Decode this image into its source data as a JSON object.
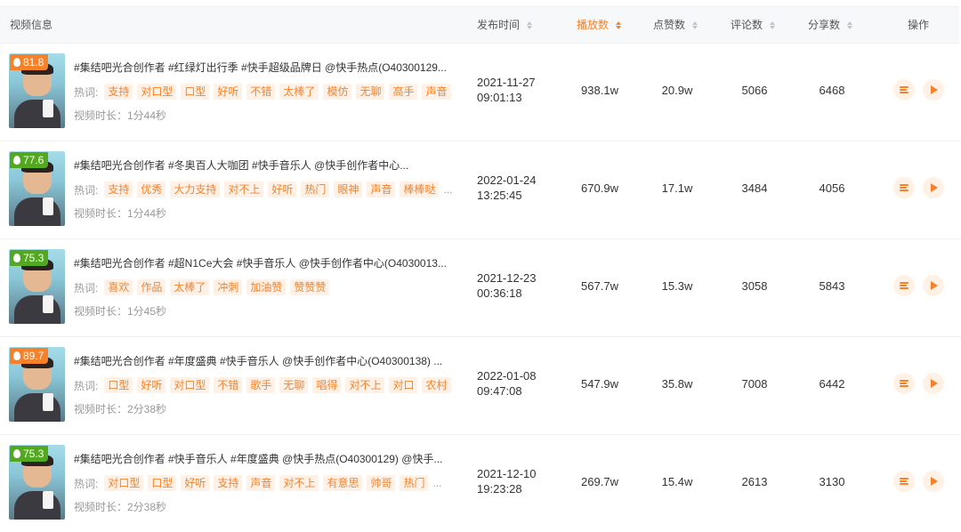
{
  "header": {
    "video_info": "视频信息",
    "publish_time": "发布时间",
    "plays": "播放数",
    "likes": "点赞数",
    "comments": "评论数",
    "shares": "分享数",
    "actions": "操作"
  },
  "colors": {
    "accent": "#f5822b",
    "score_orange": "#f5822b",
    "score_green": "#52a81e"
  },
  "rows": [
    {
      "score": "81.8",
      "score_color": "orange",
      "title": "#集结吧光合创作者 #红绿灯出行季 #快手超级品牌日 @快手热点(O40300129...",
      "hot_label": "热词:",
      "tags": [
        "支持",
        "对口型",
        "口型",
        "好听",
        "不错",
        "太棒了",
        "模仿",
        "无聊",
        "高手",
        "声音"
      ],
      "more": "",
      "duration": "视频时长：1分44秒",
      "date": "2021-11-27",
      "time": "09:01:13",
      "plays": "938.1w",
      "likes": "20.9w",
      "comments": "5066",
      "shares": "6468"
    },
    {
      "score": "77.6",
      "score_color": "green",
      "title": "#集结吧光合创作者 #冬奥百人大咖团 #快手音乐人 @快手创作者中心...",
      "hot_label": "热词:",
      "tags": [
        "支持",
        "优秀",
        "大力支持",
        "对不上",
        "好听",
        "热门",
        "眼神",
        "声音",
        "棒棒哒"
      ],
      "more": "...",
      "duration": "视频时长：1分44秒",
      "date": "2022-01-24",
      "time": "13:25:45",
      "plays": "670.9w",
      "likes": "17.1w",
      "comments": "3484",
      "shares": "4056"
    },
    {
      "score": "75.3",
      "score_color": "green",
      "title": "#集结吧光合创作者 #超N1Ce大会 #快手音乐人 @快手创作者中心(O4030013...",
      "hot_label": "热词:",
      "tags": [
        "喜欢",
        "作品",
        "太棒了",
        "冲刺",
        "加油赞",
        "赞赞赞"
      ],
      "more": "",
      "duration": "视频时长：1分45秒",
      "date": "2021-12-23",
      "time": "00:36:18",
      "plays": "567.7w",
      "likes": "15.3w",
      "comments": "3058",
      "shares": "5843"
    },
    {
      "score": "89.7",
      "score_color": "orange",
      "title": "#集结吧光合创作者 #年度盛典 #快手音乐人 @快手创作者中心(O40300138) ...",
      "hot_label": "热词:",
      "tags": [
        "口型",
        "好听",
        "对口型",
        "不错",
        "歌手",
        "无聊",
        "唱得",
        "对不上",
        "对口",
        "农村"
      ],
      "more": "",
      "duration": "视频时长：2分38秒",
      "date": "2022-01-08",
      "time": "09:47:08",
      "plays": "547.9w",
      "likes": "35.8w",
      "comments": "7008",
      "shares": "6442"
    },
    {
      "score": "75.3",
      "score_color": "green",
      "title": "#集结吧光合创作者 #快手音乐人 #年度盛典 @快手热点(O40300129) @快手...",
      "hot_label": "热词:",
      "tags": [
        "对口型",
        "口型",
        "好听",
        "支持",
        "声音",
        "对不上",
        "有意思",
        "帅哥",
        "热门"
      ],
      "more": "...",
      "duration": "视频时长：2分38秒",
      "date": "2021-12-10",
      "time": "19:23:28",
      "plays": "269.7w",
      "likes": "15.4w",
      "comments": "2613",
      "shares": "3130"
    }
  ]
}
